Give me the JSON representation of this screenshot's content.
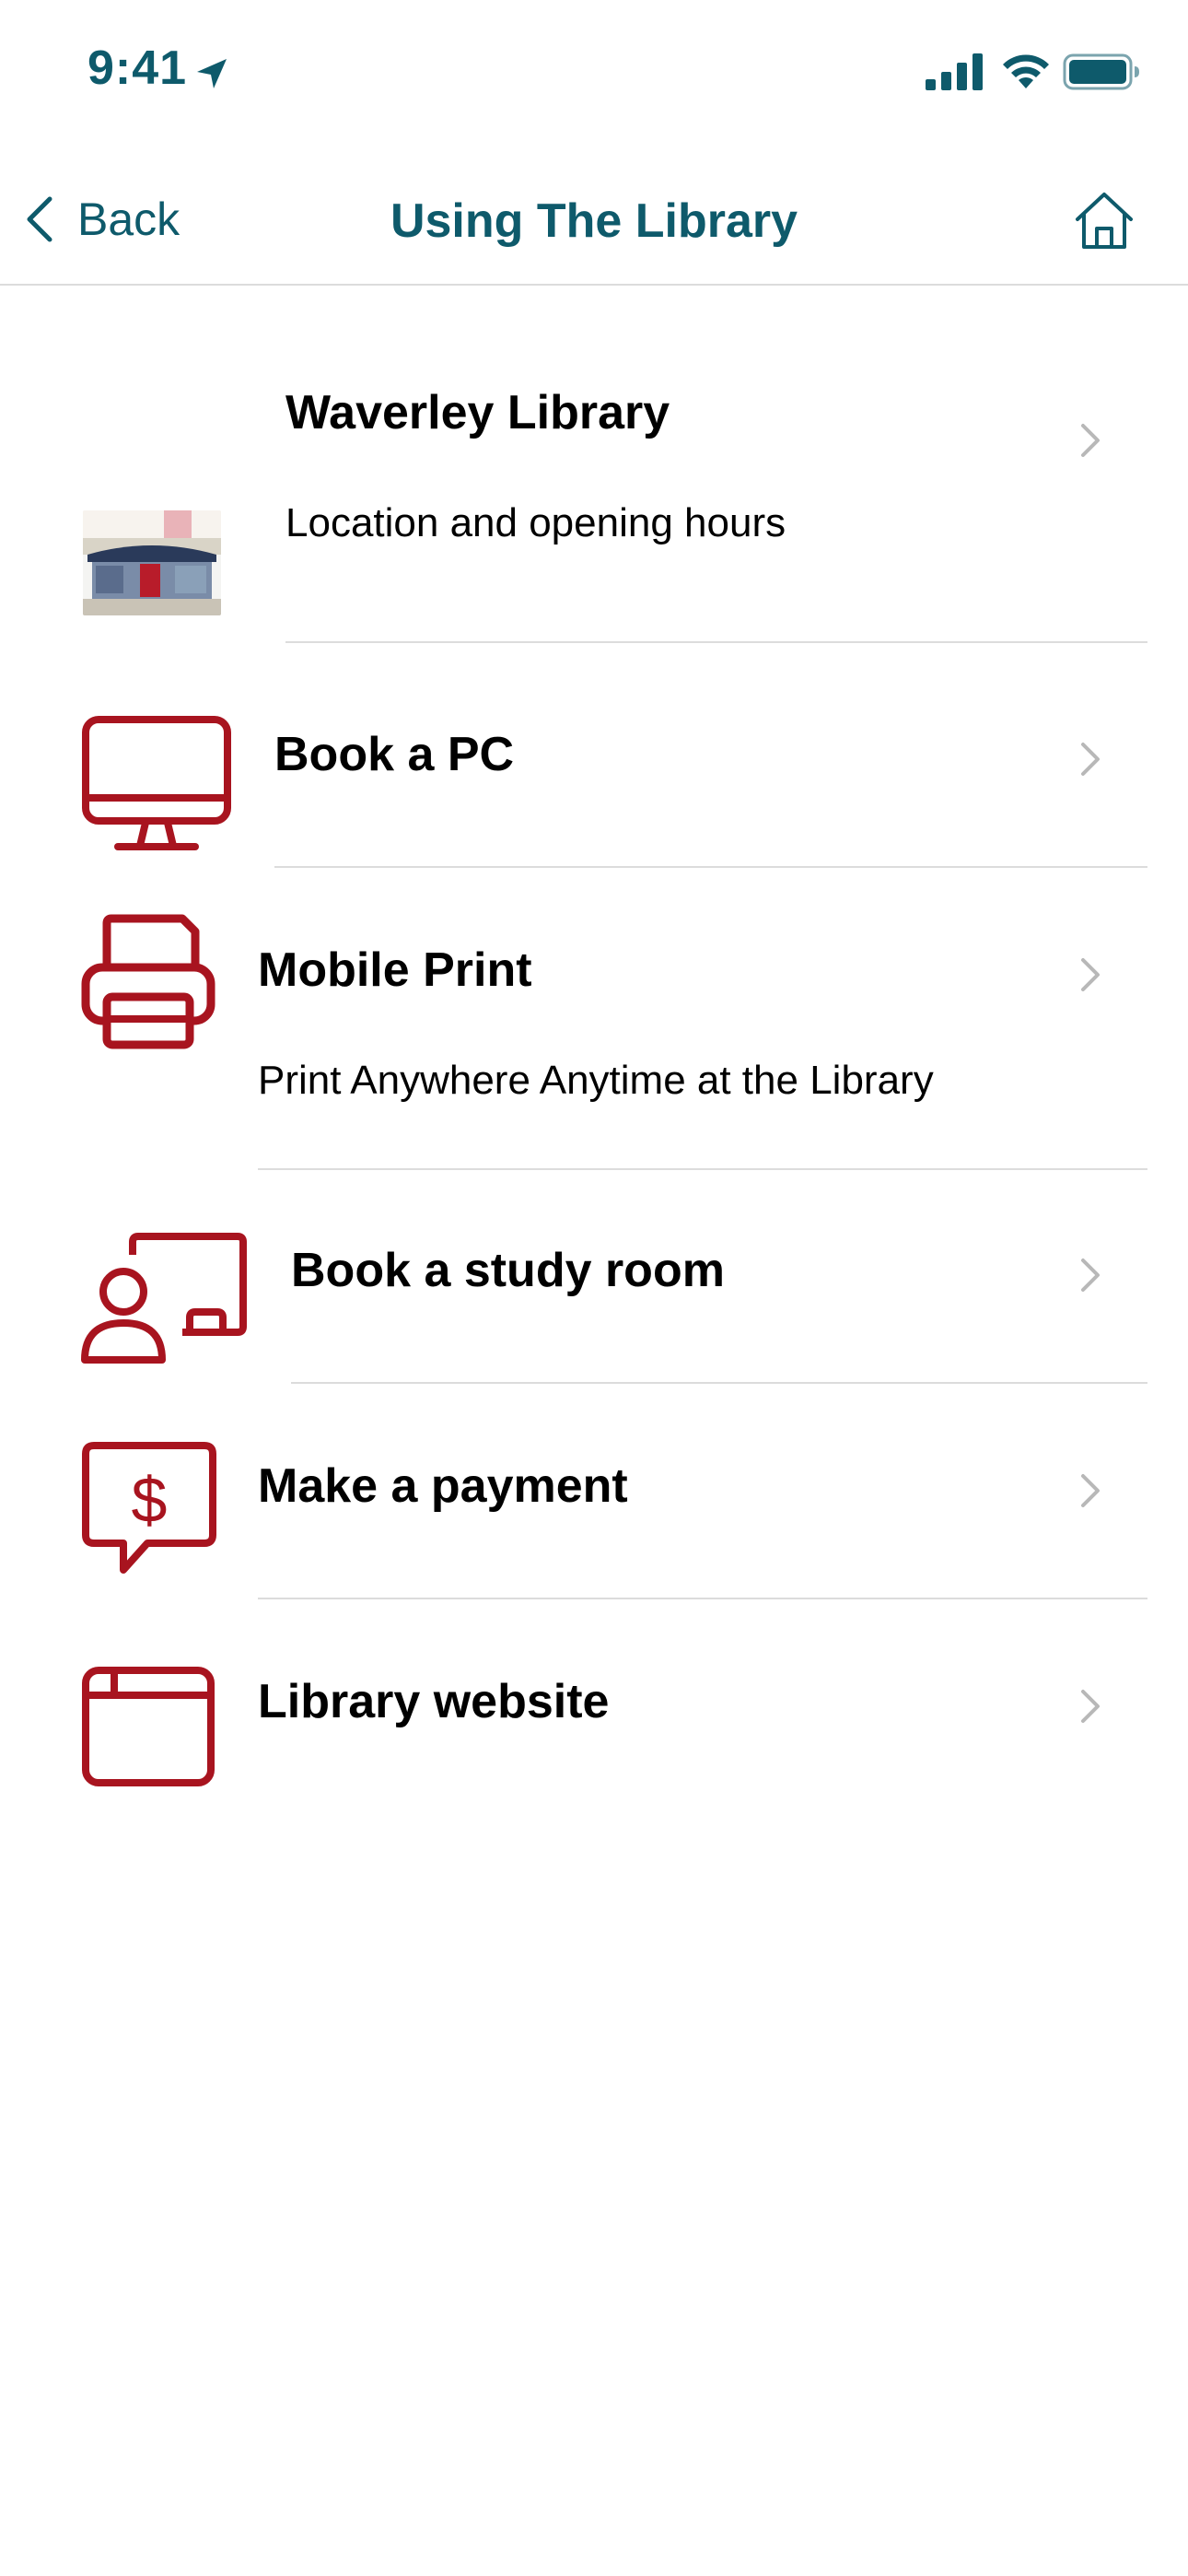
{
  "status_bar": {
    "time": "9:41",
    "icons": [
      "location-arrow-icon",
      "cellular-signal-icon",
      "wifi-icon",
      "battery-icon"
    ]
  },
  "nav": {
    "back_label": "Back",
    "title": "Using The Library",
    "home_icon": "home-icon"
  },
  "colors": {
    "accent": "#0e5a6b",
    "icon_red": "#a8141f",
    "divider": "#dcdcdc",
    "chevron": "#b8b8b8"
  },
  "items": [
    {
      "title": "Waverley Library",
      "subtitle": "Location and opening hours",
      "icon": "library-building-photo"
    },
    {
      "title": "Book a PC",
      "subtitle": "",
      "icon": "desktop-computer-icon"
    },
    {
      "title": "Mobile Print",
      "subtitle": "Print Anywhere Anytime at the Library",
      "icon": "printer-icon"
    },
    {
      "title": "Book a study room",
      "subtitle": "",
      "icon": "study-room-icon"
    },
    {
      "title": "Make a payment",
      "subtitle": "",
      "icon": "payment-icon"
    },
    {
      "title": "Library website",
      "subtitle": "",
      "icon": "browser-window-icon"
    }
  ]
}
